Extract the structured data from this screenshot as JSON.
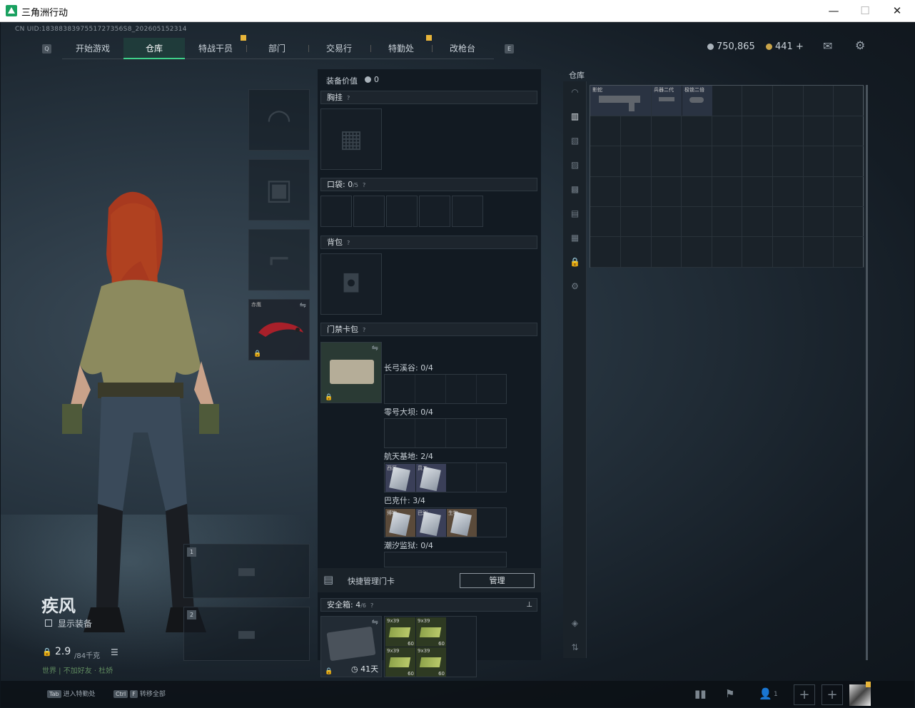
{
  "window": {
    "title": "三角洲行动",
    "minimize": "—",
    "maximize": "☐",
    "close": "✕"
  },
  "header": {
    "uid": "CN UID:1838838397551727356S8_202605152314",
    "nav": [
      "开始游戏",
      "仓库",
      "特战干员",
      "部门",
      "交易行",
      "特勤处",
      "改枪台"
    ],
    "active_nav": "仓库",
    "currency_silver": "750,865",
    "currency_gold": "441",
    "plus": "+"
  },
  "colors": {
    "accent": "#3fd18a",
    "badge": "#e8b53a",
    "card_blue": "#3a3f58",
    "ammo_green": "#2e3a22"
  },
  "icons": [
    "mail-icon",
    "gear-icon",
    "lock-icon",
    "swap-icon",
    "clock-icon",
    "pin-icon",
    "list-icon",
    "chart-icon",
    "flag-icon",
    "friends-icon"
  ],
  "character": {
    "name": "疾风",
    "show_gear": "显示装备",
    "weight": "2.9",
    "weight_max": "/84千克",
    "status": "世界 | 不加好友 · 杜娇",
    "melee_tag": "赤鹰",
    "slot1": "1",
    "slot2": "2"
  },
  "middle": {
    "equip_value_label": "装备价值",
    "equip_value": "0",
    "chest_rig": "胸挂",
    "pockets": "口袋: 0",
    "pockets_cap": "/5",
    "backpack": "背包",
    "keycard_pack": "门禁卡包",
    "maps": [
      {
        "label": "长弓溪谷: 0/4",
        "cards": []
      },
      {
        "label": "零号大坝: 0/4",
        "cards": []
      },
      {
        "label": "航天基地: 2/4",
        "cards": [
          {
            "tag": "西区"
          },
          {
            "tag": "员工"
          }
        ]
      },
      {
        "label": "巴克什: 3/4",
        "cards": [
          {
            "tag": "博物"
          },
          {
            "tag": "巴别"
          },
          {
            "tag": "生物"
          }
        ]
      },
      {
        "label": "潮汐监狱: 0/4",
        "cards": []
      }
    ],
    "quick_manage": "快捷管理门卡",
    "manage_btn": "管理",
    "safe_box": "安全箱: 4",
    "safe_cap": "/6",
    "safe_timer": "41天",
    "ammo": [
      {
        "tag": "9x39",
        "count": "60"
      },
      {
        "tag": "9x39",
        "count": "60"
      },
      {
        "tag": "9x39",
        "count": "60"
      },
      {
        "tag": "9x39",
        "count": "60"
      }
    ]
  },
  "warehouse": {
    "title": "仓库",
    "items": [
      {
        "tag": "影蛇"
      },
      {
        "tag": "兵器二代"
      },
      {
        "tag": "极锁二倍"
      }
    ]
  },
  "bottom": {
    "tab_key": "Tab",
    "tab_label": "进入特勤处",
    "ctrl_key": "Ctrl",
    "f_key": "F",
    "transfer_label": "转移全部",
    "friends_count": "1",
    "add": "+"
  }
}
